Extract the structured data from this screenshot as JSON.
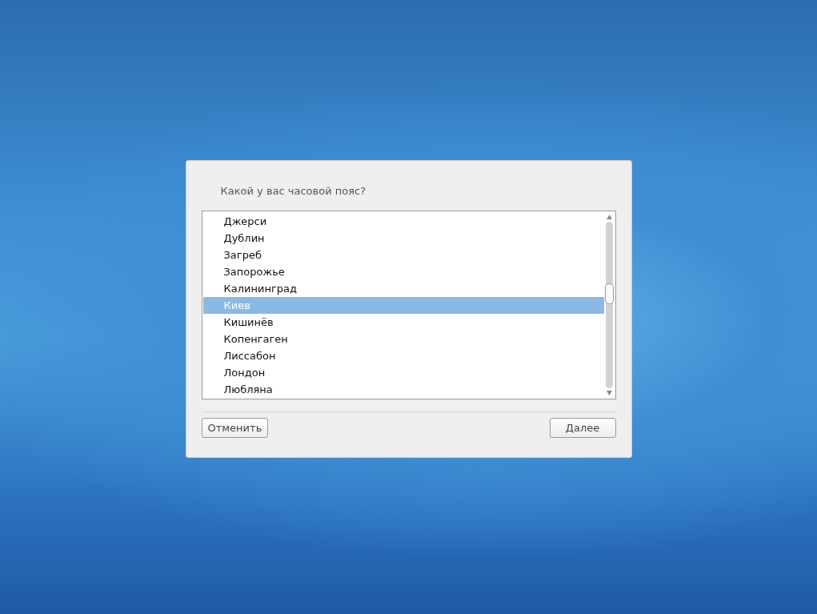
{
  "dialog": {
    "question": "Какой у вас часовой пояс?",
    "timezones": [
      {
        "label": "Джерси",
        "selected": false
      },
      {
        "label": "Дублин",
        "selected": false
      },
      {
        "label": "Загреб",
        "selected": false
      },
      {
        "label": "Запорожье",
        "selected": false
      },
      {
        "label": "Калининград",
        "selected": false
      },
      {
        "label": "Киев",
        "selected": true
      },
      {
        "label": "Кишинёв",
        "selected": false
      },
      {
        "label": "Копенгаген",
        "selected": false
      },
      {
        "label": "Лиссабон",
        "selected": false
      },
      {
        "label": "Лондон",
        "selected": false
      },
      {
        "label": "Любляна",
        "selected": false
      }
    ],
    "buttons": {
      "cancel": "Отменить",
      "next": "Далее"
    }
  }
}
